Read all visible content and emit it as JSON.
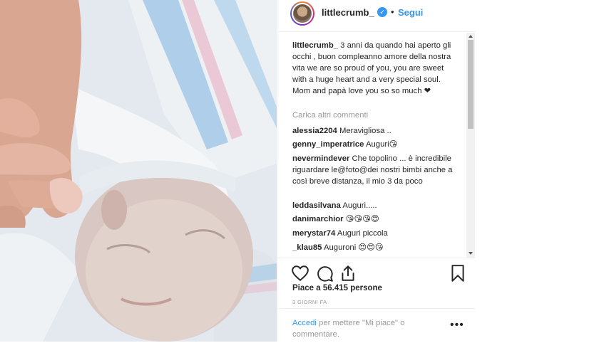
{
  "post": {
    "username": "littlecrumb_",
    "follow_label": "Segui",
    "dot": "•",
    "verified_icon": "verified-badge-icon",
    "caption_text": "3 anni da quando hai aperto gli occhi , buon compleanno amore della nostra vita we are so proud of you, you are sweet with a huge heart and a very special soul. Mom and papà love you so so much ❤︎"
  },
  "comments": {
    "load_more_label": "Carica altri commenti",
    "items": [
      {
        "user": "alessia2204",
        "text": "Meravigliosa .."
      },
      {
        "user": "genny_imperatrice",
        "text": "Auguri😘"
      },
      {
        "user": "nevermindever",
        "text": "Che topolino ... è incredibile riguardare le@foto@dei nostri bimbi anche a così breve distanza, il mio 3 da poco"
      },
      {
        "user": "leddasilvana",
        "text": "Auguri....."
      },
      {
        "user": "danimarchior",
        "text": "😘😘😘😍"
      },
      {
        "user": "merystar74",
        "text": "Auguri piccola"
      },
      {
        "user": "_klau85",
        "text": "Auguroni 😍😍😘"
      }
    ]
  },
  "actions": {
    "likes_text": "Piace a 56.415 persone",
    "time_text": "3 GIORNI FA",
    "login_link": "Accedi",
    "login_rest": " per mettere \"Mi piace\" o commentare.",
    "more_label": "•••"
  },
  "colors": {
    "accent": "#3897f0",
    "muted": "#999999",
    "text": "#262626"
  }
}
